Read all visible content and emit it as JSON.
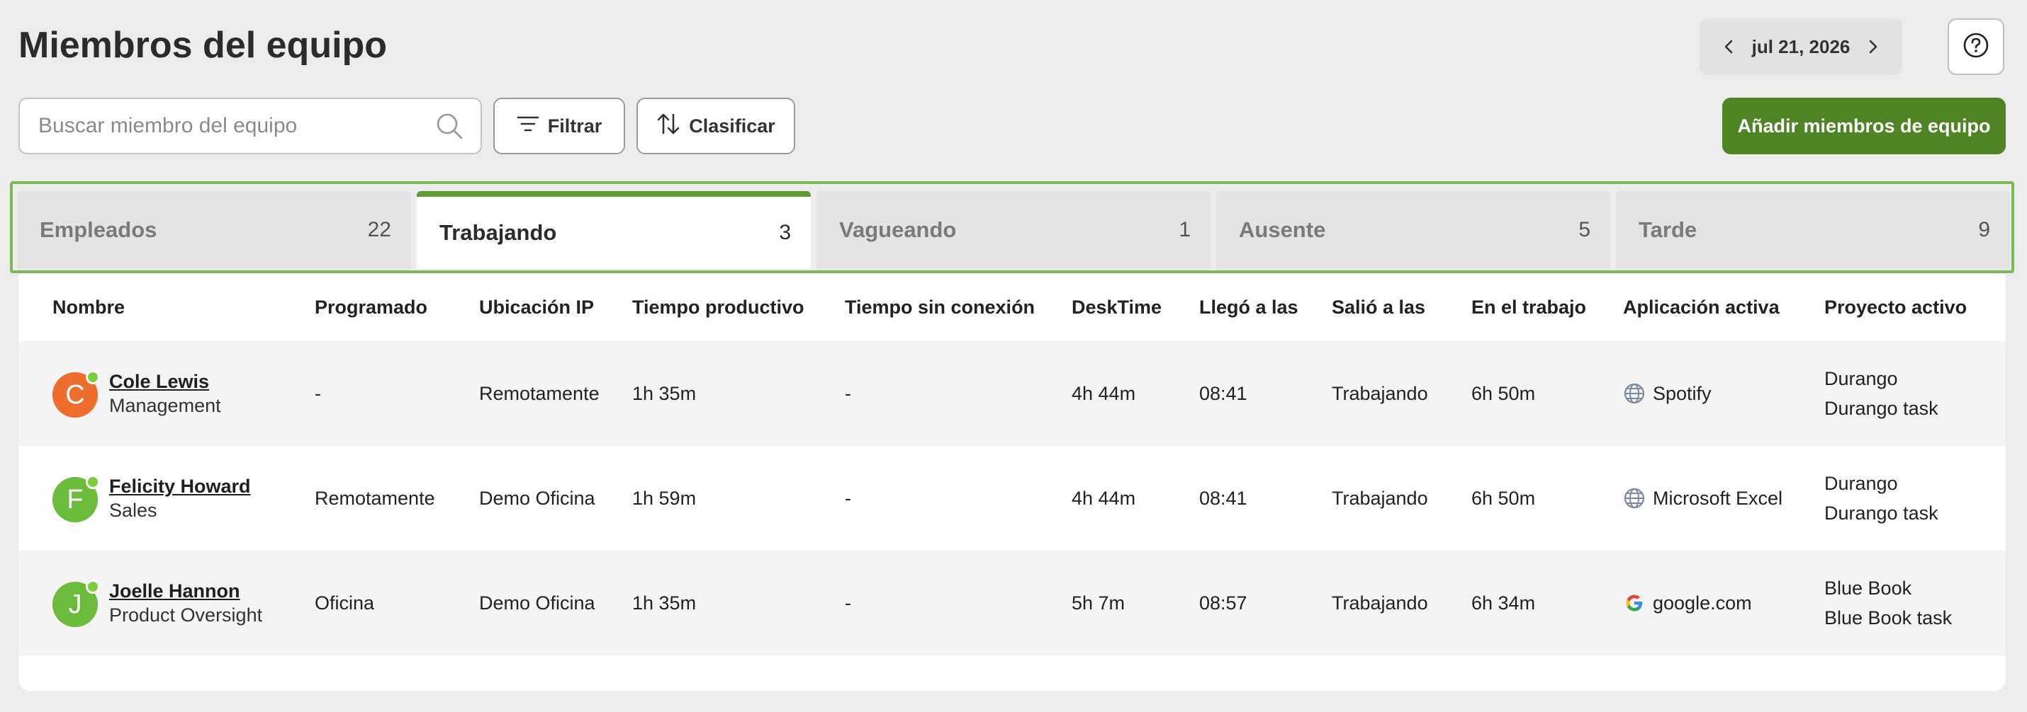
{
  "header": {
    "title": "Miembros del equipo",
    "date": "jul 21, 2026"
  },
  "toolbar": {
    "search_placeholder": "Buscar miembro del equipo",
    "filter_label": "Filtrar",
    "sort_label": "Clasificar",
    "add_label": "Añadir miembros de equipo"
  },
  "colors": {
    "accent": "#4f8424",
    "tab_highlight": "#7cb955",
    "online_dot": "#7ccc3e"
  },
  "tabs": [
    {
      "label": "Empleados",
      "count": "22"
    },
    {
      "label": "Trabajando",
      "count": "3"
    },
    {
      "label": "Vagueando",
      "count": "1"
    },
    {
      "label": "Ausente",
      "count": "5"
    },
    {
      "label": "Tarde",
      "count": "9"
    }
  ],
  "active_tab": "Trabajando",
  "table": {
    "columns": [
      "Nombre",
      "Programado",
      "Ubicación IP",
      "Tiempo productivo",
      "Tiempo sin conexión",
      "DeskTime",
      "Llegó a las",
      "Salió a las",
      "En el trabajo",
      "Aplicación activa",
      "Proyecto activo"
    ],
    "rows": [
      {
        "initial": "C",
        "avatar_color": "#ee6c2c",
        "name": "Cole Lewis",
        "role": "Management",
        "scheduled": "-",
        "ip_location": "Remotamente",
        "productive_time": "1h 35m",
        "offline_time": "-",
        "desktime": "4h 44m",
        "arrived": "08:41",
        "left": "Trabajando",
        "at_work": "6h 50m",
        "app_icon": "globe-icon",
        "app": "Spotify",
        "project": "Durango",
        "task": "Durango task"
      },
      {
        "initial": "F",
        "avatar_color": "#6cbb3c",
        "name": "Felicity Howard",
        "role": "Sales",
        "scheduled": "Remotamente",
        "ip_location": "Demo Oficina",
        "productive_time": "1h 59m",
        "offline_time": "-",
        "desktime": "4h 44m",
        "arrived": "08:41",
        "left": "Trabajando",
        "at_work": "6h 50m",
        "app_icon": "globe-icon",
        "app": "Microsoft Excel",
        "project": "Durango",
        "task": "Durango task"
      },
      {
        "initial": "J",
        "avatar_color": "#6cbb3c",
        "name": "Joelle Hannon",
        "role": "Product Oversight",
        "scheduled": "Oficina",
        "ip_location": "Demo Oficina",
        "productive_time": "1h 35m",
        "offline_time": "-",
        "desktime": "5h 7m",
        "arrived": "08:57",
        "left": "Trabajando",
        "at_work": "6h 34m",
        "app_icon": "google-icon",
        "app": "google.com",
        "project": "Blue Book",
        "task": "Blue Book task"
      }
    ]
  }
}
